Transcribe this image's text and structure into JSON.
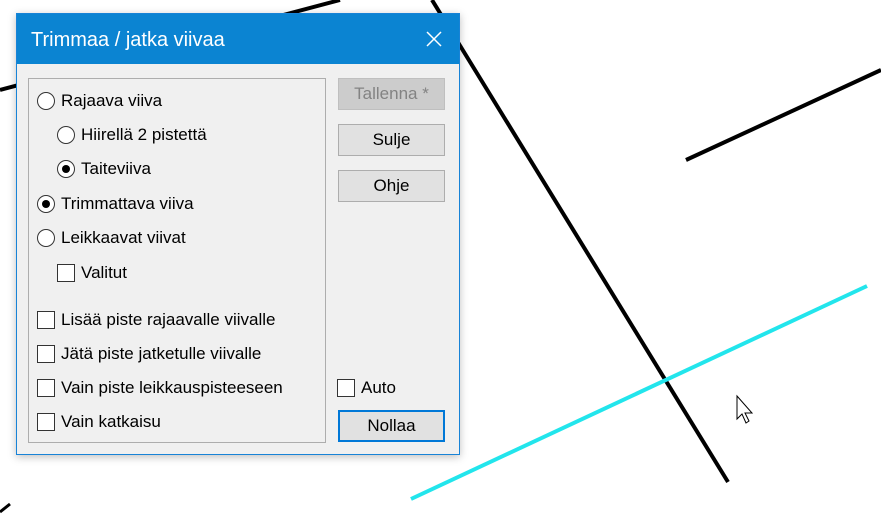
{
  "dialog": {
    "title": "Trimmaa / jatka viivaa",
    "options": {
      "rajaava_viiva": "Rajaava viiva",
      "hiirella": "Hiirellä 2 pistettä",
      "taiteviiva": "Taiteviiva",
      "trimmattava": "Trimmattava viiva",
      "leikkaavat": "Leikkaavat viivat",
      "valitut": "Valitut",
      "lisaa_piste": "Lisää piste rajaavalle viivalle",
      "jata_piste": "Jätä piste jatketulle viivalle",
      "vain_piste": "Vain piste leikkauspisteeseen",
      "vain_katkaisu": "Vain katkaisu",
      "auto": "Auto"
    },
    "buttons": {
      "tallenna": "Tallenna *",
      "sulje": "Sulje",
      "ohje": "Ohje",
      "nollaa": "Nollaa"
    }
  },
  "colors": {
    "titlebar": "#0b84d2",
    "highlight_line": "#22e5ec",
    "line": "#000000"
  }
}
